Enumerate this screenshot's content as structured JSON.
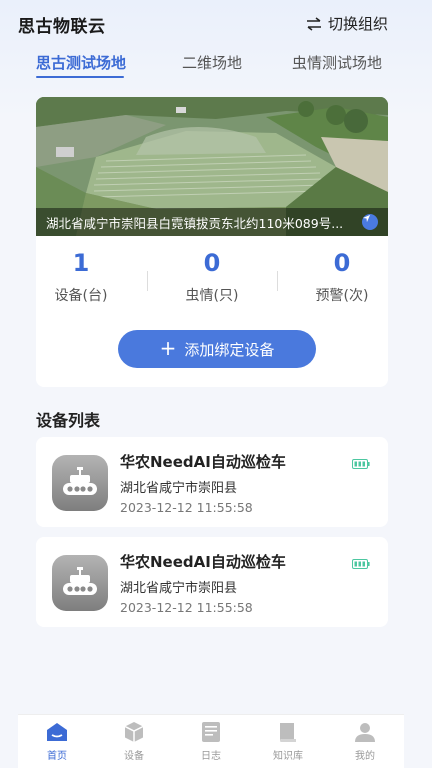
{
  "header": {
    "title": "思古物联云",
    "switch_org_label": "切换组织"
  },
  "tabs": [
    {
      "label": "思古测试场地",
      "active": true
    },
    {
      "label": "二维场地",
      "active": false
    },
    {
      "label": "虫情测试场地",
      "active": false
    }
  ],
  "farm": {
    "address": "湖北省咸宁市崇阳县白霓镇拔贡东北约110米089号..."
  },
  "stats": [
    {
      "value": "1",
      "label": "设备(台)"
    },
    {
      "value": "0",
      "label": "虫情(只)"
    },
    {
      "value": "0",
      "label": "预警(次)"
    }
  ],
  "add_device_label": "添加绑定设备",
  "device_list": {
    "title": "设备列表",
    "items": [
      {
        "name": "华农NeedAI自动巡检车",
        "address": "湖北省咸宁市崇阳县",
        "time": "2023-12-12    11:55:58"
      },
      {
        "name": "华农NeedAI自动巡检车",
        "address": "湖北省咸宁市崇阳县",
        "time": "2023-12-12    11:55:58"
      }
    ]
  },
  "bottom_nav": [
    {
      "label": "首页",
      "icon": "home-icon",
      "active": true
    },
    {
      "label": "设备",
      "icon": "cube-icon",
      "active": false
    },
    {
      "label": "日志",
      "icon": "log-icon",
      "active": false
    },
    {
      "label": "知识库",
      "icon": "book-icon",
      "active": false
    },
    {
      "label": "我的",
      "icon": "user-icon",
      "active": false
    }
  ],
  "colors": {
    "accent": "#3c6bd5",
    "button": "#4a79dd",
    "battery": "#4cc7a0"
  }
}
